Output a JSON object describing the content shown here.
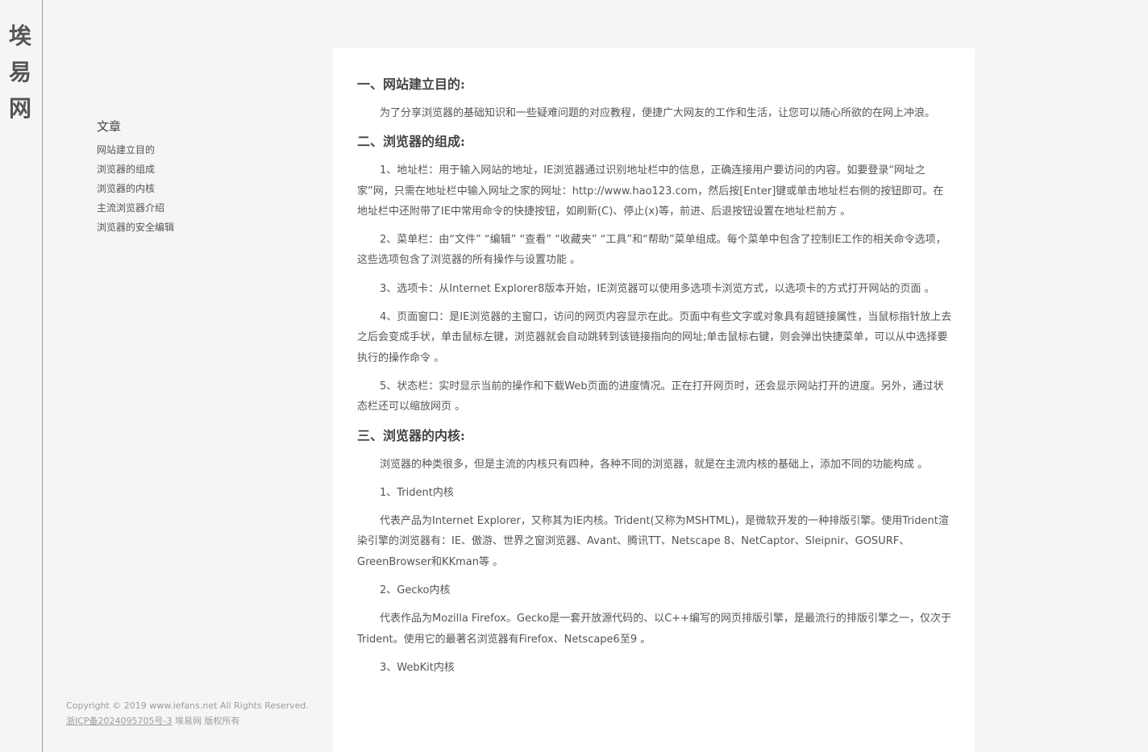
{
  "brand": {
    "name": "埃易网"
  },
  "sidebar": {
    "heading": "文章",
    "items": [
      {
        "label": "网站建立目的"
      },
      {
        "label": "浏览器的组成"
      },
      {
        "label": "浏览器的内核"
      },
      {
        "label": "主流浏览器介绍"
      },
      {
        "label": "浏览器的安全编辑"
      }
    ]
  },
  "footer": {
    "copyright": "Copyright © 2019 www.iefans.net All Rights Reserved.",
    "icp": "浙ICP备2024095705号-3",
    "rights": " 埃易网 版权所有"
  },
  "article": {
    "sections": [
      {
        "title": "一、网站建立目的:",
        "paragraphs": [
          "为了分享浏览器的基础知识和一些疑难问题的对应教程，便捷广大网友的工作和生活，让您可以随心所欲的在网上冲浪。"
        ]
      },
      {
        "title": "二、浏览器的组成:",
        "paragraphs": [
          "1、地址栏：用于输入网站的地址，IE浏览器通过识别地址栏中的信息，正确连接用户要访问的内容。如要登录“网址之家”网，只需在地址栏中输入网址之家的网址：http://www.hao123.com，然后按[Enter]键或单击地址栏右侧的按钮即可。在地址栏中还附带了IE中常用命令的快捷按钮，如刷新(C)、停止(x)等，前进、后退按钮设置在地址栏前方 。",
          "2、菜单栏：由“文件” “编辑” “查看” “收藏夹” “工具”和“帮助”菜单组成。每个菜单中包含了控制IE工作的相关命令选项，这些选项包含了浏览器的所有操作与设置功能 。",
          "3、选项卡：从Internet Explorer8版本开始，IE浏览器可以使用多选项卡浏览方式，以选项卡的方式打开网站的页面 。",
          "4、页面窗口：是IE浏览器的主窗口，访问的网页内容显示在此。页面中有些文字或对象具有超链接属性，当鼠标指针放上去之后会变成手状，单击鼠标左键，浏览器就会自动跳转到该链接指向的网址;单击鼠标右键，则会弹出快捷菜单，可以从中选择要执行的操作命令 。",
          "5、状态栏：实时显示当前的操作和下载Web页面的进度情况。正在打开网页时，还会显示网站打开的进度。另外，通过状态栏还可以缩放网页 。"
        ]
      },
      {
        "title": "三、浏览器的内核:",
        "paragraphs": [
          "浏览器的种类很多，但是主流的内核只有四种，各种不同的浏览器，就是在主流内核的基础上，添加不同的功能构成 。",
          "1、Trident内核",
          "代表产品为Internet Explorer，又称其为IE内核。Trident(又称为MSHTML)，是微软开发的一种排版引擎。使用Trident渲染引擎的浏览器有：IE、傲游、世界之窗浏览器、Avant、腾讯TT、Netscape 8、NetCaptor、Sleipnir、GOSURF、GreenBrowser和KKman等 。",
          "2、Gecko内核",
          "代表作品为Mozilla Firefox。Gecko是一套开放源代码的、以C++编写的网页排版引擎，是最流行的排版引擎之一，仅次于Trident。使用它的最著名浏览器有Firefox、Netscape6至9 。",
          "3、WebKit内核"
        ]
      }
    ]
  }
}
